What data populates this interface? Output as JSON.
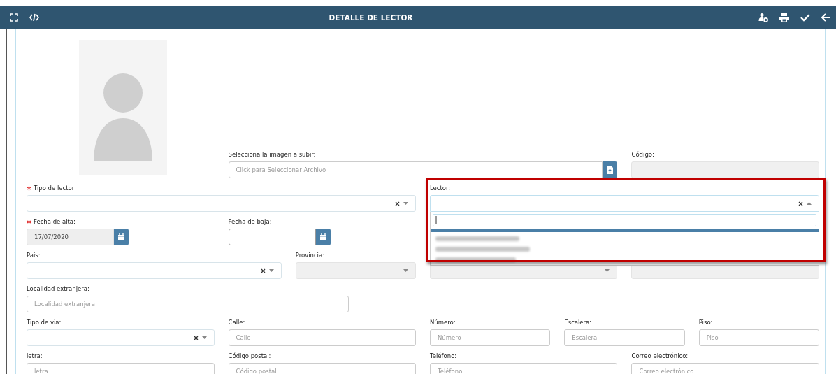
{
  "window": {
    "title": "DETALLE DE LECTOR"
  },
  "rows": [
    [
      {
        "kind": "file",
        "label": "Selecciona la imagen a subir:",
        "placeholder": "Click para Seleccionar Archivo"
      },
      {
        "kind": "text",
        "label": "Código:",
        "disabled": true
      }
    ],
    [
      {
        "kind": "select",
        "label": "Tipo de lector:",
        "required": true,
        "expanded": false
      },
      {
        "kind": "select",
        "label": "Lector:",
        "expanded": true,
        "highlighted": true,
        "options": [
          {
            "kind": "blurred"
          },
          {
            "kind": "blurred"
          },
          {
            "kind": "blurred"
          }
        ]
      }
    ],
    [
      {
        "kind": "date",
        "label": "Fecha de alta:",
        "required": true,
        "value": "17/07/2020",
        "disabled": true
      },
      {
        "kind": "date",
        "label": "Fecha de baja:"
      }
    ],
    [
      {
        "kind": "select",
        "label": "Pais:",
        "expanded": false
      },
      {
        "kind": "select",
        "label": "Provincia:",
        "disabled": true,
        "expanded": false
      },
      {
        "kind": "select",
        "disabled": true,
        "expanded": false
      },
      {
        "kind": "text",
        "disabled": true
      }
    ],
    [
      {
        "kind": "text",
        "label": "Localidad extranjera:",
        "placeholder": "Localidad extranjera"
      }
    ],
    [
      {
        "kind": "select",
        "label": "Tipo de via:",
        "expanded": false
      },
      {
        "kind": "text",
        "label": "Calle:",
        "placeholder": "Calle"
      },
      {
        "kind": "text",
        "label": "Número:",
        "placeholder": "Número"
      },
      {
        "kind": "text",
        "label": "Escalera:",
        "placeholder": "Escalera"
      },
      {
        "kind": "text",
        "label": "Piso:",
        "placeholder": "Piso"
      }
    ],
    [
      {
        "kind": "text",
        "label": "letra:",
        "placeholder": "letra"
      },
      {
        "kind": "text",
        "label": "Código postal:",
        "placeholder": "Código postal"
      },
      {
        "kind": "text",
        "label": "Teléfono:",
        "placeholder": "Teléfono"
      },
      {
        "kind": "text",
        "label": "Correo electrónico:",
        "placeholder": "Correo electrónico"
      }
    ]
  ]
}
